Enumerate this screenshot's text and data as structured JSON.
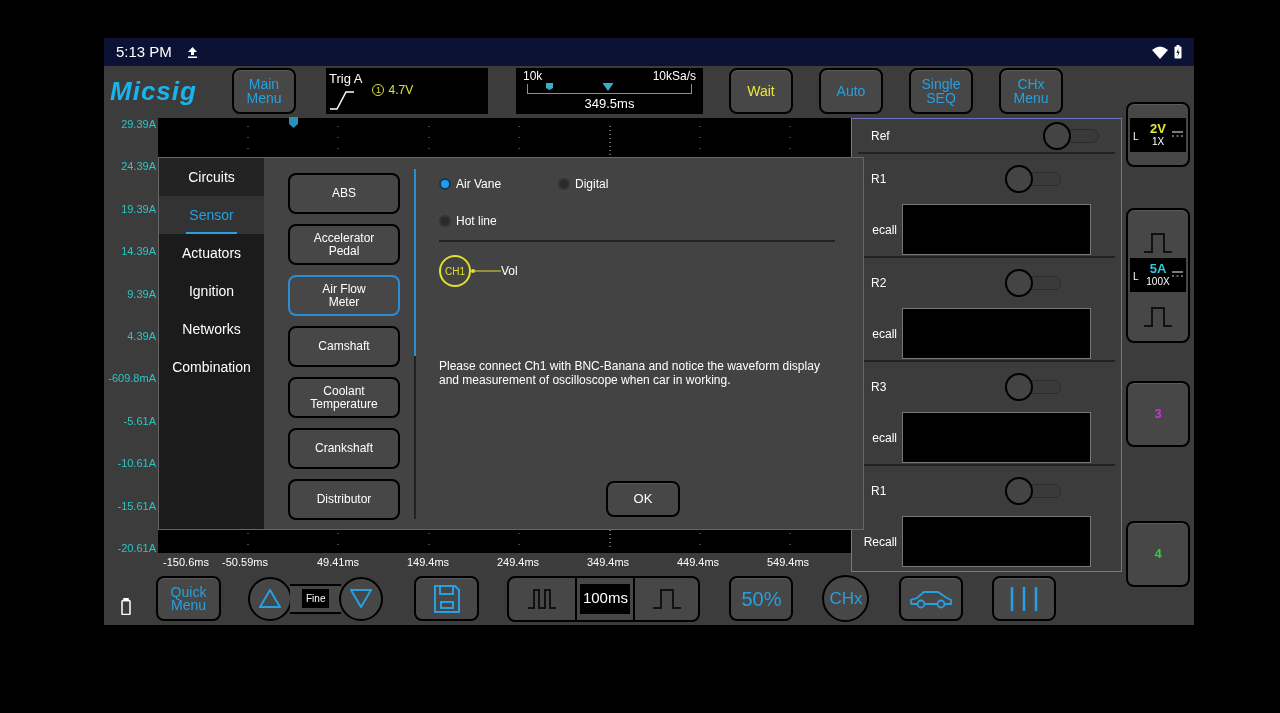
{
  "status_bar": {
    "time": "5:13 PM"
  },
  "toolbar": {
    "logo": "Micsig",
    "main_menu": "Main Menu",
    "trigger": {
      "label": "Trig A",
      "source": "1",
      "voltage": "4.7V"
    },
    "timebase": {
      "memory_depth": "10k",
      "sample_rate": "10kSa/s",
      "position": "349.5ms",
      "level": 0.49
    },
    "buttons": [
      {
        "label": "Wait",
        "color": "#e8e838"
      },
      {
        "label": "Auto",
        "color": "#26a0e0"
      },
      {
        "label": "Single SEQ",
        "color": "#26a0e0"
      },
      {
        "label": "CHx Menu",
        "color": "#26a0e0"
      }
    ]
  },
  "plot": {
    "y_labels": [
      "29.39A",
      "24.39A",
      "19.39A",
      "14.39A",
      "9.39A",
      "4.39A",
      "-609.8mA",
      "-5.61A",
      "-10.61A",
      "-15.61A",
      "-20.61A"
    ],
    "x_labels": [
      "-150.6ms",
      "-50.59ms",
      "49.41ms",
      "149.4ms",
      "249.4ms",
      "349.4ms",
      "449.4ms",
      "549.4ms"
    ]
  },
  "reference_panel": {
    "title": "Ref",
    "on": false,
    "slots": [
      {
        "label": "R1",
        "on": false,
        "recall_label": "ecall"
      },
      {
        "label": "R2",
        "on": false,
        "recall_label": "ecall"
      },
      {
        "label": "R3",
        "on": false,
        "recall_label": "ecall"
      },
      {
        "label": "R1",
        "on": false,
        "recall_label": "Recall"
      }
    ]
  },
  "dialog": {
    "categories": [
      {
        "label": "Circuits",
        "selected": false
      },
      {
        "label": "Sensor",
        "selected": true
      },
      {
        "label": "Actuators",
        "selected": false
      },
      {
        "label": "Ignition",
        "selected": false
      },
      {
        "label": "Networks",
        "selected": false
      },
      {
        "label": "Combination",
        "selected": false
      }
    ],
    "sensors": [
      {
        "label": "ABS",
        "selected": false
      },
      {
        "label": "Accelerator Pedal",
        "selected": false
      },
      {
        "label": "Air Flow Meter",
        "selected": true
      },
      {
        "label": "Camshaft",
        "selected": false
      },
      {
        "label": "Coolant Temperature",
        "selected": false
      },
      {
        "label": "Crankshaft",
        "selected": false
      },
      {
        "label": "Distributor",
        "selected": false
      }
    ],
    "modes": [
      {
        "label": "Air Vane",
        "selected": true
      },
      {
        "label": "Digital",
        "selected": false
      },
      {
        "label": "Hot line",
        "selected": false
      }
    ],
    "probe": {
      "channel": "CH1",
      "signal": "Vol"
    },
    "description": "Please connect Ch1 with BNC-Banana and notice the waveform display and measurement of oscilloscope when car in working.",
    "ok": "OK"
  },
  "channels": [
    {
      "kind": "probe",
      "coupling": "L",
      "scale": "2V",
      "probe": "1X",
      "color": "#e8e838"
    },
    {
      "kind": "probe_with_position",
      "coupling": "L",
      "scale": "5A",
      "probe": "100X",
      "color": "#2ec8e0"
    },
    {
      "kind": "number",
      "label": "3",
      "color": "#d030d8"
    },
    {
      "kind": "number",
      "label": "4",
      "color": "#30d040"
    }
  ],
  "bottom_toolbar": {
    "quick_menu": "Quick Menu",
    "fine": "Fine",
    "time_per_div": "100ms",
    "trigger_level": "50%",
    "channel": "CHx"
  }
}
